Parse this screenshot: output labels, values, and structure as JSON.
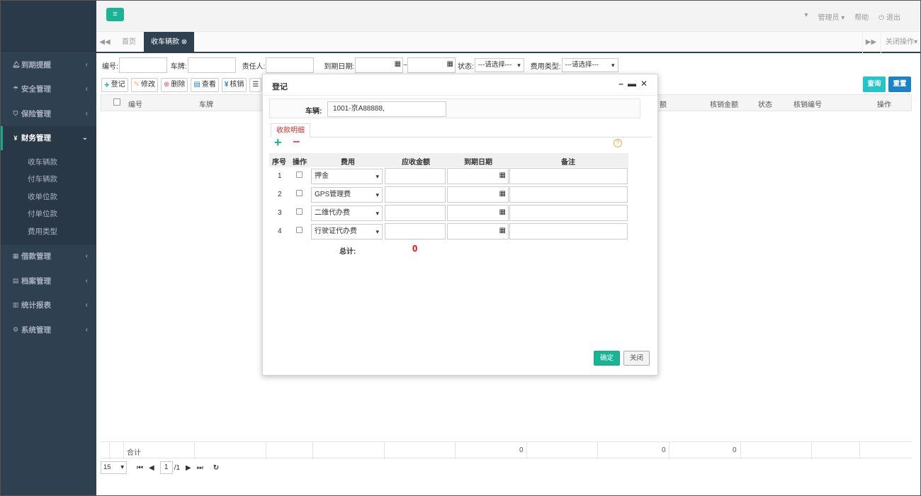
{
  "topbar": {
    "user": "管理员",
    "help": "帮助",
    "logout": "退出"
  },
  "sidebar": {
    "items": [
      {
        "label": "到期提醒",
        "icon": "bell-icon"
      },
      {
        "label": "安全管理",
        "icon": "umbrella-icon"
      },
      {
        "label": "保险管理",
        "icon": "shield-icon"
      },
      {
        "label": "财务管理",
        "icon": "yen-icon"
      },
      {
        "label": "借款管理",
        "icon": "calculator-icon"
      },
      {
        "label": "档案管理",
        "icon": "file-icon"
      },
      {
        "label": "统计报表",
        "icon": "bar-chart-icon"
      },
      {
        "label": "系统管理",
        "icon": "gear-icon"
      }
    ],
    "finance_sub": [
      "收车辆款",
      "付车辆款",
      "收单位款",
      "付单位款",
      "费用类型"
    ]
  },
  "tabs": {
    "home": "首页",
    "active": "收车辆款",
    "close_ops": "关闭操作"
  },
  "filters": {
    "number": "编号:",
    "plate": "车牌:",
    "owner": "责任人:",
    "due_date": "到期日期:",
    "range_sep": "~",
    "status": "状态:",
    "status_value": "---请选择---",
    "fee_type": "费用类型:",
    "fee_type_value": "---请选择---",
    "query": "查询",
    "reset": "重置"
  },
  "toolbar": {
    "register": "登记",
    "edit": "修改",
    "delete": "删除",
    "view": "查看",
    "verify": "核销"
  },
  "grid": {
    "headers": {
      "number": "编号",
      "plate": "车牌",
      "amount_tail": "额",
      "verified_amount": "核销金额",
      "status": "状态",
      "verify_no": "核销编号",
      "action": "操作"
    },
    "summary": {
      "label": "合计",
      "v1": "0",
      "v2": "0",
      "v3": "0"
    }
  },
  "pager": {
    "page_size": "15",
    "page": "1",
    "total_pages": "/1"
  },
  "modal": {
    "title": "登记",
    "vehicle_label": "车辆:",
    "vehicle_value": "1001-京A88888,",
    "tab": "收款明细",
    "help": "?",
    "columns": {
      "index": "序号",
      "op": "操作",
      "fee": "费用",
      "receivable": "应收金额",
      "due": "到期日期",
      "remark": "备注"
    },
    "rows": [
      {
        "index": "1",
        "fee": "押金"
      },
      {
        "index": "2",
        "fee": "GPS管理费"
      },
      {
        "index": "3",
        "fee": "二维代办费"
      },
      {
        "index": "4",
        "fee": "行驶证代办费"
      }
    ],
    "total_label": "总计:",
    "total_value": "0",
    "confirm": "确定",
    "close": "关闭"
  },
  "colors": {
    "sidebar": "#2f4050",
    "accent": "#1ab394",
    "query": "#23c6c8",
    "reset": "#1c84c6",
    "danger": "#ed5565"
  }
}
